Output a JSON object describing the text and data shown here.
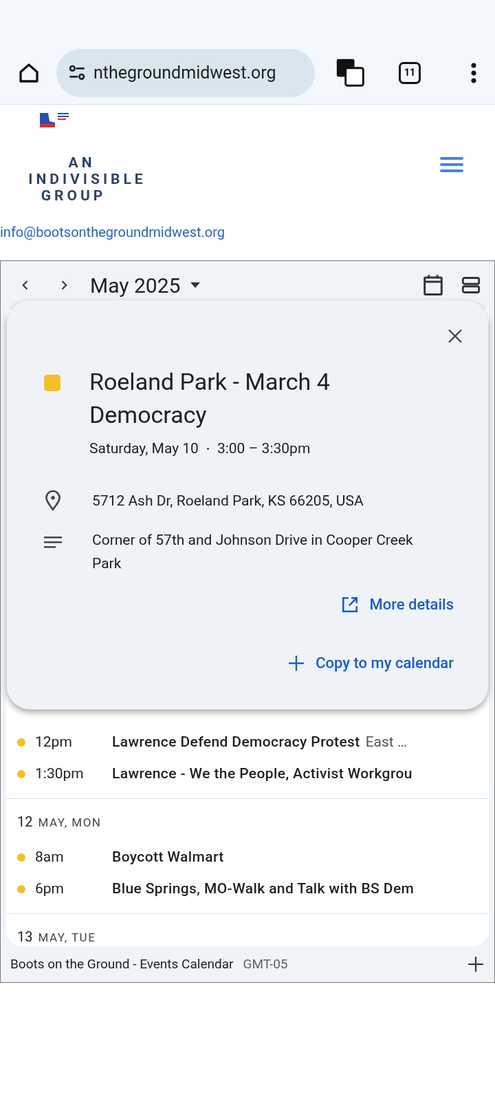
{
  "browser": {
    "url": "nthegroundmidwest.org",
    "tab_count": "11"
  },
  "site": {
    "tagline": [
      "AN",
      "INDIVISIBLE",
      "GROUP"
    ],
    "email": "info@bootsonthegroundmidwest.org"
  },
  "calendar": {
    "month": "May 2025",
    "days": [
      {
        "events": [
          {
            "time": "12pm",
            "title": "Lawrence Defend Democracy Protest",
            "location": "East …",
            "color": "#f6bf26"
          },
          {
            "time": "1:30pm",
            "title": "Lawrence - We the People, Activist Workgrou",
            "color": "#f6bf26"
          }
        ]
      },
      {
        "day": "12",
        "label": "MAY, MON",
        "events": [
          {
            "time": "8am",
            "title": "Boycott Walmart",
            "color": "#f6bf26"
          },
          {
            "time": "6pm",
            "title": "Blue Springs, MO-Walk and Talk with BS Dem",
            "color": "#f6bf26"
          }
        ]
      },
      {
        "day": "13",
        "label": "MAY, TUE"
      }
    ],
    "footer": {
      "name": "Boots on the Ground - Events Calendar",
      "timezone": "GMT-05"
    }
  },
  "popup": {
    "title": "Roeland Park - March 4 Democracy",
    "color": "#f6bf26",
    "date": "Saturday, May 10",
    "time": "3:00 – 3:30pm",
    "location": "5712 Ash Dr, Roeland Park, KS 66205, USA",
    "description": "Corner of 57th and Johnson Drive in Cooper Creek Park",
    "more_details": "More details",
    "copy": "Copy to my calendar"
  }
}
